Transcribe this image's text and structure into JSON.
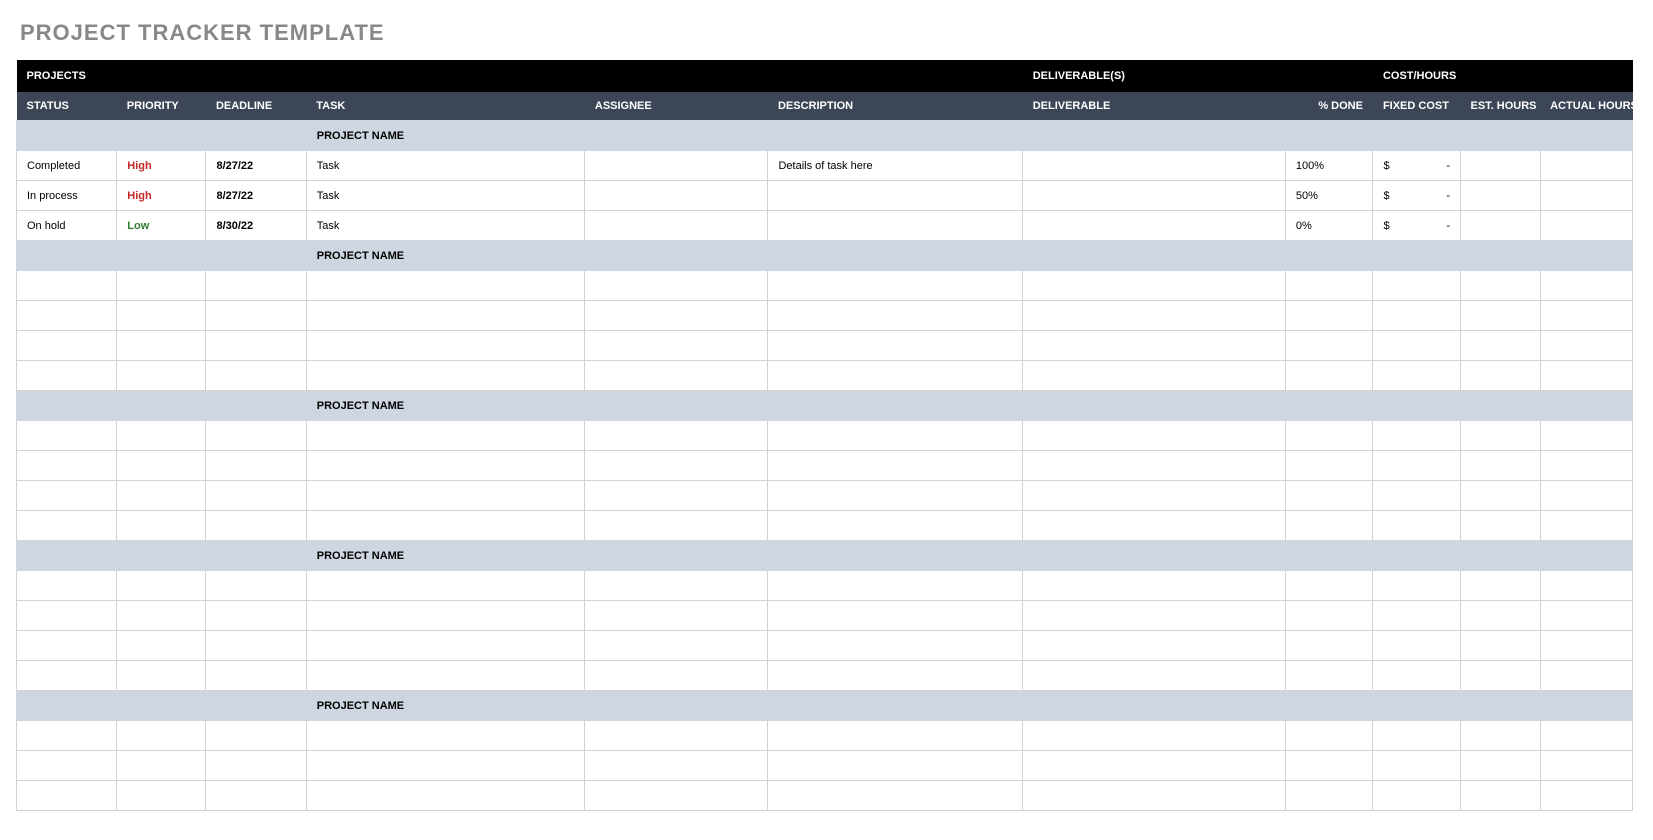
{
  "title": "PROJECT TRACKER TEMPLATE",
  "topband": {
    "projects": "PROJECTS",
    "deliverables": "DELIVERABLE(S)",
    "cost": "COST/HOURS"
  },
  "headers": {
    "status": "STATUS",
    "priority": "PRIORITY",
    "deadline": "DEADLINE",
    "task": "TASK",
    "assignee": "ASSIGNEE",
    "description": "DESCRIPTION",
    "deliverable": "DELIVERABLE",
    "pctdone": "% DONE",
    "fixedcost": "FIXED COST",
    "esthours": "EST. HOURS",
    "actualhours": "ACTUAL HOURS"
  },
  "section_label": "PROJECT NAME",
  "cost_symbol": "$",
  "cost_dash": "-",
  "sections": [
    {
      "name": "PROJECT NAME",
      "rows": [
        {
          "status": "Completed",
          "priority": "High",
          "priority_level": "high",
          "deadline": "8/27/22",
          "task": "Task",
          "assignee": "",
          "description": "Details of task here",
          "deliverable": "",
          "pctdone": "100%",
          "fixedcost": "$  -",
          "esthours": "",
          "actualhours": ""
        },
        {
          "status": "In process",
          "priority": "High",
          "priority_level": "high",
          "deadline": "8/27/22",
          "task": "Task",
          "assignee": "",
          "description": "",
          "deliverable": "",
          "pctdone": "50%",
          "fixedcost": "$  -",
          "esthours": "",
          "actualhours": ""
        },
        {
          "status": "On hold",
          "priority": "Low",
          "priority_level": "low",
          "deadline": "8/30/22",
          "task": "Task",
          "assignee": "",
          "description": "",
          "deliverable": "",
          "pctdone": "0%",
          "fixedcost": "$  -",
          "esthours": "",
          "actualhours": ""
        }
      ]
    },
    {
      "name": "PROJECT NAME",
      "rows": [
        {},
        {},
        {},
        {}
      ]
    },
    {
      "name": "PROJECT NAME",
      "rows": [
        {},
        {},
        {},
        {}
      ]
    },
    {
      "name": "PROJECT NAME",
      "rows": [
        {},
        {},
        {},
        {}
      ]
    },
    {
      "name": "PROJECT NAME",
      "rows": [
        {},
        {},
        {}
      ]
    }
  ]
}
